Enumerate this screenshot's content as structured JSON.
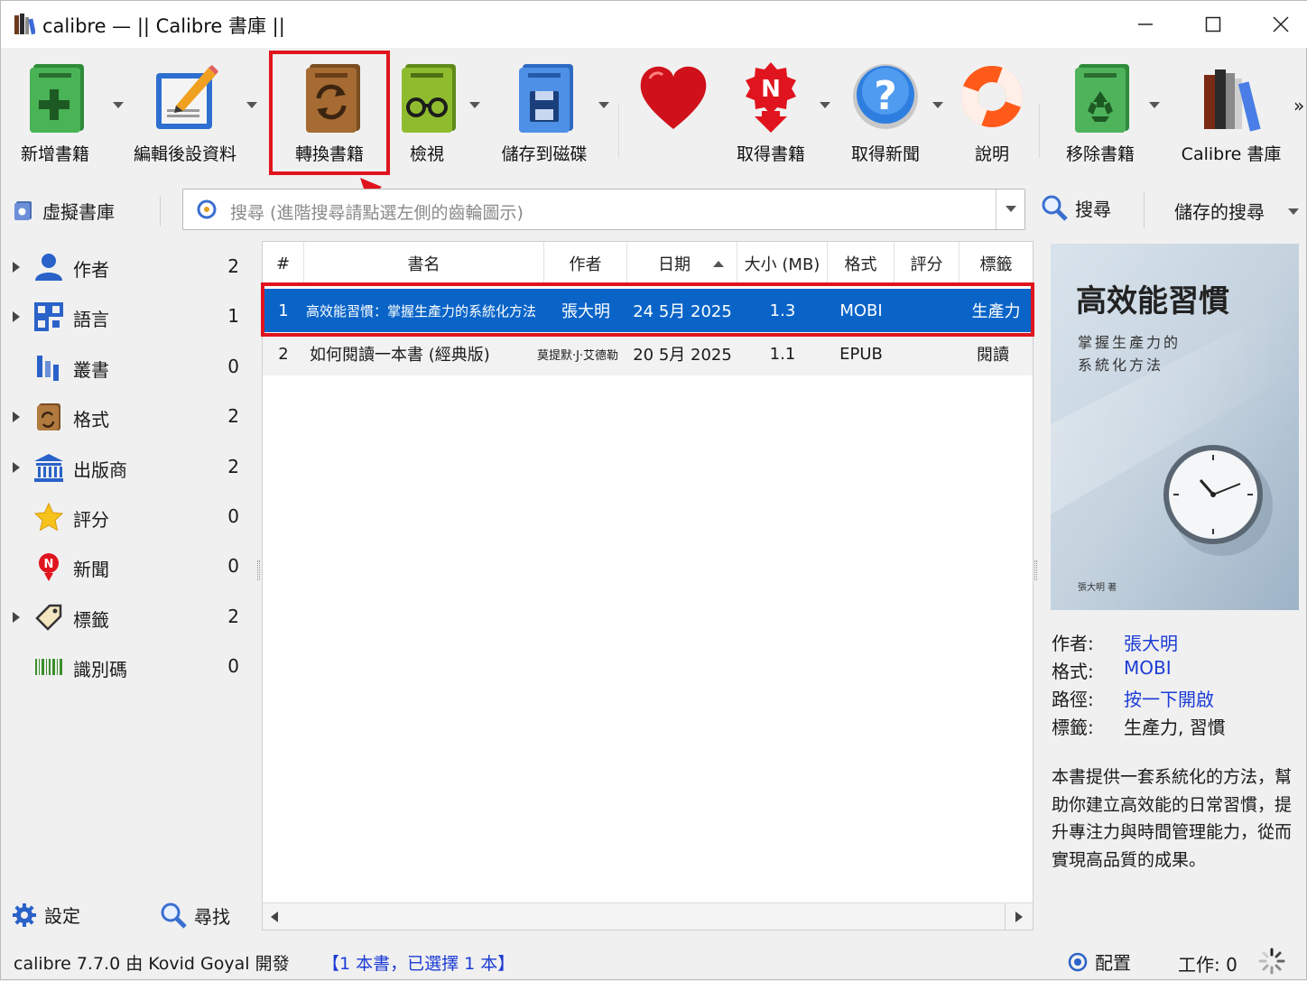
{
  "window": {
    "title": "calibre — || Calibre 書庫 ||"
  },
  "toolbar": {
    "add_books": "新增書籍",
    "edit_metadata": "編輯後設資料",
    "convert_books": "轉換書籍",
    "view": "檢視",
    "save_to_disk": "儲存到磁碟",
    "get_books": "取得書籍",
    "fetch_news": "取得新聞",
    "help": "說明",
    "remove_books": "移除書籍",
    "calibre_library": "Calibre 書庫",
    "more": "»"
  },
  "search": {
    "virtual_library": "虛擬書庫",
    "placeholder": "搜尋 (進階搜尋請點選左側的齒輪圖示)",
    "search_button": "搜尋",
    "saved_searches": "儲存的搜尋"
  },
  "tag_browser": {
    "items": [
      {
        "label": "作者",
        "count": "2",
        "icon": "user-icon"
      },
      {
        "label": "語言",
        "count": "1",
        "icon": "language-icon"
      },
      {
        "label": "叢書",
        "count": "0",
        "icon": "series-icon"
      },
      {
        "label": "格式",
        "count": "2",
        "icon": "format-icon"
      },
      {
        "label": "出版商",
        "count": "2",
        "icon": "publisher-icon"
      },
      {
        "label": "評分",
        "count": "0",
        "icon": "star-icon"
      },
      {
        "label": "新聞",
        "count": "0",
        "icon": "news-icon"
      },
      {
        "label": "標籤",
        "count": "2",
        "icon": "tag-icon"
      },
      {
        "label": "識別碼",
        "count": "0",
        "icon": "barcode-icon"
      }
    ]
  },
  "book_list": {
    "columns": [
      "#",
      "書名",
      "作者",
      "日期",
      "大小 (MB)",
      "格式",
      "評分",
      "標籤"
    ],
    "rows": [
      {
        "num": "1",
        "title": "高效能習慣：掌握生產力的系統化方法",
        "author": "張大明",
        "date": "24 5月 2025",
        "size": "1.3",
        "format": "MOBI",
        "rating": "",
        "tags": "生產力"
      },
      {
        "num": "2",
        "title": "如何閱讀一本書 (經典版)",
        "author": "莫提默·J·艾德勒",
        "date": "20 5月 2025",
        "size": "1.1",
        "format": "EPUB",
        "rating": "",
        "tags": "閱讀"
      }
    ]
  },
  "cover": {
    "title": "高效能習慣",
    "subtitle_line1": "掌握生產力的",
    "subtitle_line2": "系統化方法",
    "author": "張大明 著"
  },
  "details": {
    "author_key": "作者:",
    "author_val": "張大明",
    "format_key": "格式:",
    "format_val": "MOBI",
    "path_key": "路徑:",
    "path_val": "按一下開啟",
    "tags_key": "標籤:",
    "tags_val": "生產力, 習慣",
    "description": "本書提供一套系統化的方法，幫助你建立高效能的日常習慣，提升專注力與時間管理能力，從而實現高品質的成果。"
  },
  "bottom": {
    "settings": "設定",
    "find": "尋找"
  },
  "status": {
    "version": "calibre 7.7.0 由 Kovid Goyal 開發",
    "selection": "【1 本書，已選擇 1 本】",
    "layout": "配置",
    "jobs": "工作:  0"
  },
  "colors": {
    "highlight_red": "#e0141e",
    "selection_blue": "#0a64c8",
    "link_blue": "#1c3cd6"
  }
}
